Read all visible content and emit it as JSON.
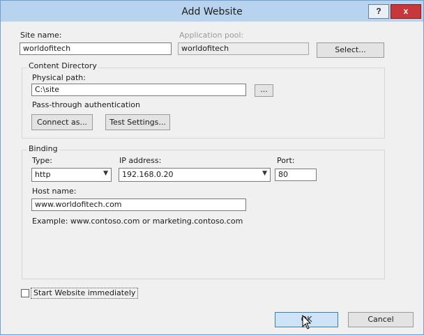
{
  "window": {
    "title": "Add Website",
    "help_label": "?",
    "close_label": "x"
  },
  "site": {
    "name_label": "Site name:",
    "name_value": "worldofitech"
  },
  "app_pool": {
    "label": "Application pool:",
    "value": "worldofitech",
    "select_label": "Select..."
  },
  "content": {
    "group_label": "Content Directory",
    "physical_path_label": "Physical path:",
    "physical_path_value": "C:\\site",
    "browse_label": "...",
    "pass_through_label": "Pass-through authentication",
    "connect_as_label": "Connect as...",
    "test_settings_label": "Test Settings..."
  },
  "binding": {
    "group_label": "Binding",
    "type_label": "Type:",
    "type_value": "http",
    "ip_label": "IP address:",
    "ip_value": "192.168.0.20",
    "port_label": "Port:",
    "port_value": "80",
    "host_label": "Host name:",
    "host_value": "www.worldofitech.com",
    "example_text": "Example: www.contoso.com or marketing.contoso.com"
  },
  "options": {
    "start_immediately_label": "Start Website immediately",
    "start_immediately_checked": false
  },
  "footer": {
    "ok_label": "OK",
    "cancel_label": "Cancel"
  }
}
